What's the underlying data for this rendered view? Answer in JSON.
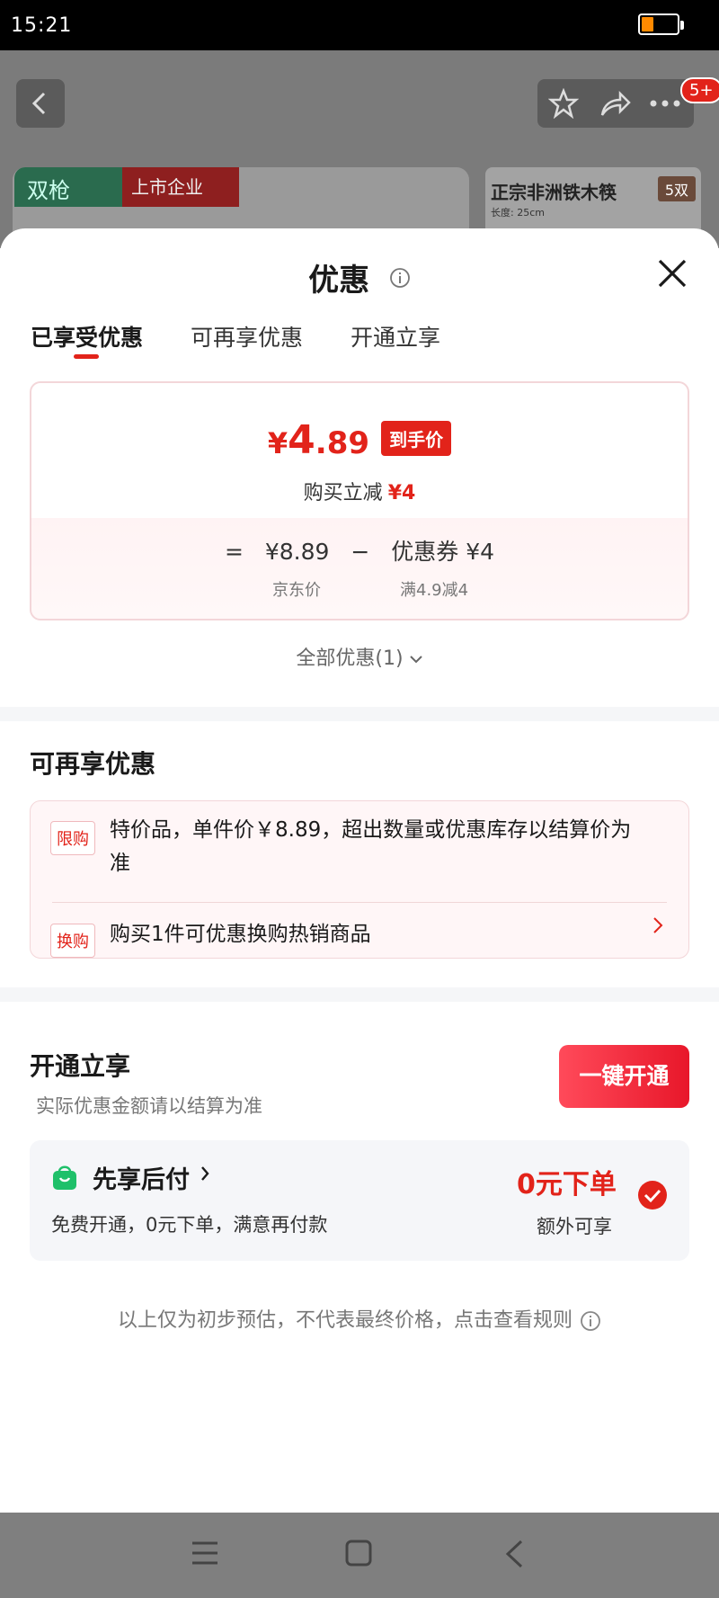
{
  "status_bar": {
    "time": "15:21",
    "battery_level": 0.3,
    "battery_color": "#ff8a00"
  },
  "background_page": {
    "badge": "5+",
    "brand_name": "双枪",
    "brand_tag": "上市企业",
    "product_title": "正宗非洲铁木筷",
    "product_pair": "5双",
    "product_length": "长度: 25cm"
  },
  "sheet": {
    "title": "优惠",
    "tabs": [
      {
        "label": "已享受优惠",
        "active": true
      },
      {
        "label": "可再享优惠",
        "active": false
      },
      {
        "label": "开通立享",
        "active": false
      }
    ],
    "price": {
      "currency": "¥",
      "int": "4",
      "dec": ".89",
      "tag": "到手价",
      "reduce_label": "购买立减",
      "reduce_value": "¥4",
      "formula_eq": "=",
      "jd_price": "¥8.89",
      "minus": "−",
      "coupon": "优惠券 ¥4",
      "jd_label": "京东价",
      "coupon_rule": "满4.9减4"
    },
    "all_offers": "全部优惠(1)",
    "more": {
      "title": "可再享优惠",
      "items": [
        {
          "tag": "限购",
          "text_line1": "特价品，单件价￥8.89，超出数量或优惠库存以结算价为",
          "text_line2": "准"
        },
        {
          "tag": "换购",
          "text_line1": "购买1件可优惠换购热销商品"
        }
      ]
    },
    "open": {
      "title": "开通立享",
      "subtitle": "实际优惠金额请以结算为准",
      "button": "一键开通",
      "pay_title": "先享后付",
      "pay_desc": "免费开通，0元下单，满意再付款",
      "zero": "0元下单",
      "extra": "额外可享",
      "checked": true
    },
    "disclaimer": "以上仅为初步预估，不代表最终价格，点击查看规则"
  },
  "colors": {
    "accent": "#e2231a",
    "pay_green": "#1fc06a"
  }
}
